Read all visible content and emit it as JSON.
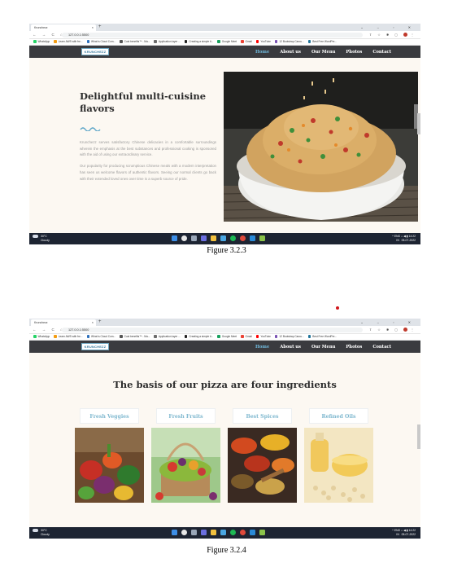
{
  "browser": {
    "tab_title": "Krunchezz",
    "url": "127.0.0.1:5500",
    "bookmarks": [
      "WhatsApp",
      "Learn AWS with fre...",
      "What is Cloud Com...",
      "Cost benefits™ - Ma...",
      "Application layer ...",
      "Creating a simple ti...",
      "Google Meet",
      "Gmail",
      "YouTube",
      "12 Bootstrap Carou...",
      "Best Free WordPre..."
    ]
  },
  "site": {
    "logo": "KRUNCHEZZ",
    "nav": [
      "Home",
      "About us",
      "Our Menu",
      "Photos",
      "Contact"
    ]
  },
  "figure1": {
    "heading_line1": "Delightful multi-cuisine",
    "heading_line2": "flavors",
    "paragraph1": "Krunchezz serves satisfactory Chinese delicacies in a comfortable surroundings wherein the emphasis at the best substances and professional cooking is sponsored with the aid of using our extraordinary service.",
    "paragraph2": "Our popularity for producing scrumptious Chinese meals with a modern interpretation has seen us welcome flavors of authentic flavors. Seeing our normal clients go back with their extended loved ones over time is a superb source of pride.",
    "caption": "Figure 3.2.3"
  },
  "figure2": {
    "heading": "The basis of our pizza are four ingredients",
    "cards": [
      "Fresh Veggies",
      "Fresh Fruits",
      "Best Spices",
      "Refined Oils"
    ],
    "caption": "Figure 3.2.4"
  },
  "taskbar": {
    "temperature": "30°C",
    "condition": "Cloudy",
    "lang": "ENG",
    "region": "IN",
    "time": "14:22",
    "date": "05-07-2022"
  },
  "colors": {
    "page_bg": "#fcf8f2",
    "nav_bg": "#3a3b3f",
    "accent": "#6fb6d8",
    "heading": "#2c2c2c",
    "taskbar": "#1d2432"
  }
}
